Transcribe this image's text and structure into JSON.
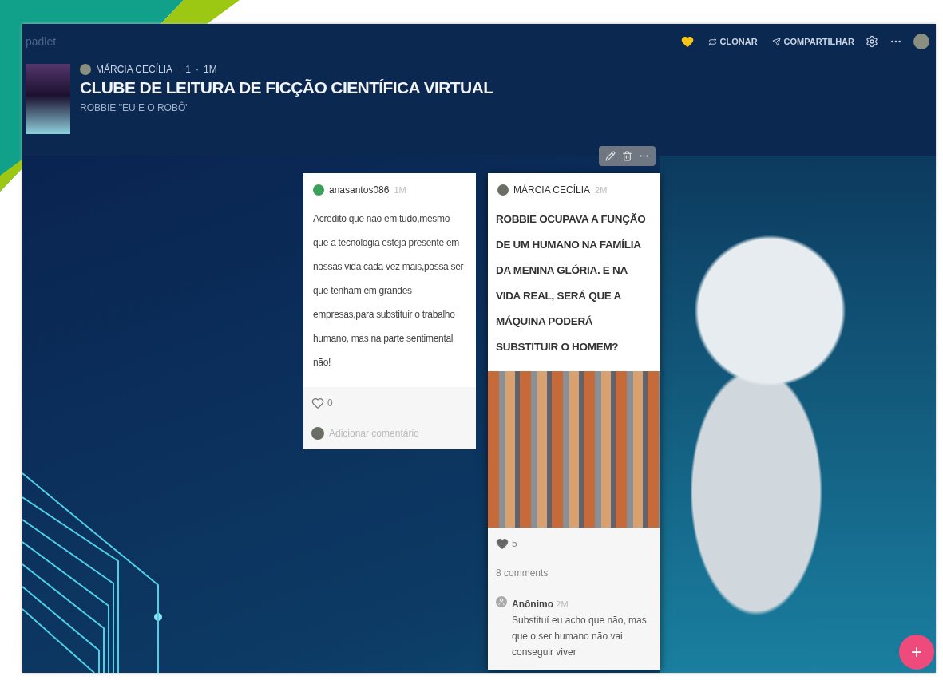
{
  "app": {
    "logo": "padlet"
  },
  "toolbar": {
    "liked": true,
    "buttons": [
      {
        "kind": "clone",
        "label": "CLONAR"
      },
      {
        "kind": "share",
        "label": "COMPARTILHAR"
      }
    ]
  },
  "board": {
    "author": "MÁRCIA CECÍLIA",
    "collaborators": "+ 1",
    "separator": "·",
    "time": "1M",
    "title": "CLUBE DE LEITURA DE FICÇÃO CIENTÍFICA VIRTUAL",
    "subtitle": "ROBBIE \"EU E O ROBÔ\""
  },
  "posts": [
    {
      "kind": "text",
      "author": "anasantos086",
      "time": "1M",
      "actions": false,
      "body": "Acredito que não em tudo,mesmo que a tecnologia esteja presente em nossas vida cada vez mais,possa ser que tenham em grandes empresas,para substituir o trabalho humano, mas na parte sentimental não!",
      "liked": false,
      "likes": "0",
      "comment_placeholder": "Adicionar comentário"
    },
    {
      "kind": "image",
      "author": "MÁRCIA CECÍLIA",
      "time": "2M",
      "actions": true,
      "body": "ROBBIE OCUPAVA A FUNÇÃO DE UM HUMANO NA FAMÍLIA DA MENINA GLÓRIA. E NA VIDA REAL, SERÁ QUE A MÁQUINA PODERÁ SUBSTITUIR O HOMEM?",
      "liked": true,
      "likes": "5",
      "comments_count": "8 comments",
      "comments": [
        {
          "author": "Anônimo",
          "time": "2M",
          "text": "Substituí eu acho que não, mas que o ser humano não vai conseguir viver"
        }
      ]
    }
  ],
  "add_button": "+"
}
